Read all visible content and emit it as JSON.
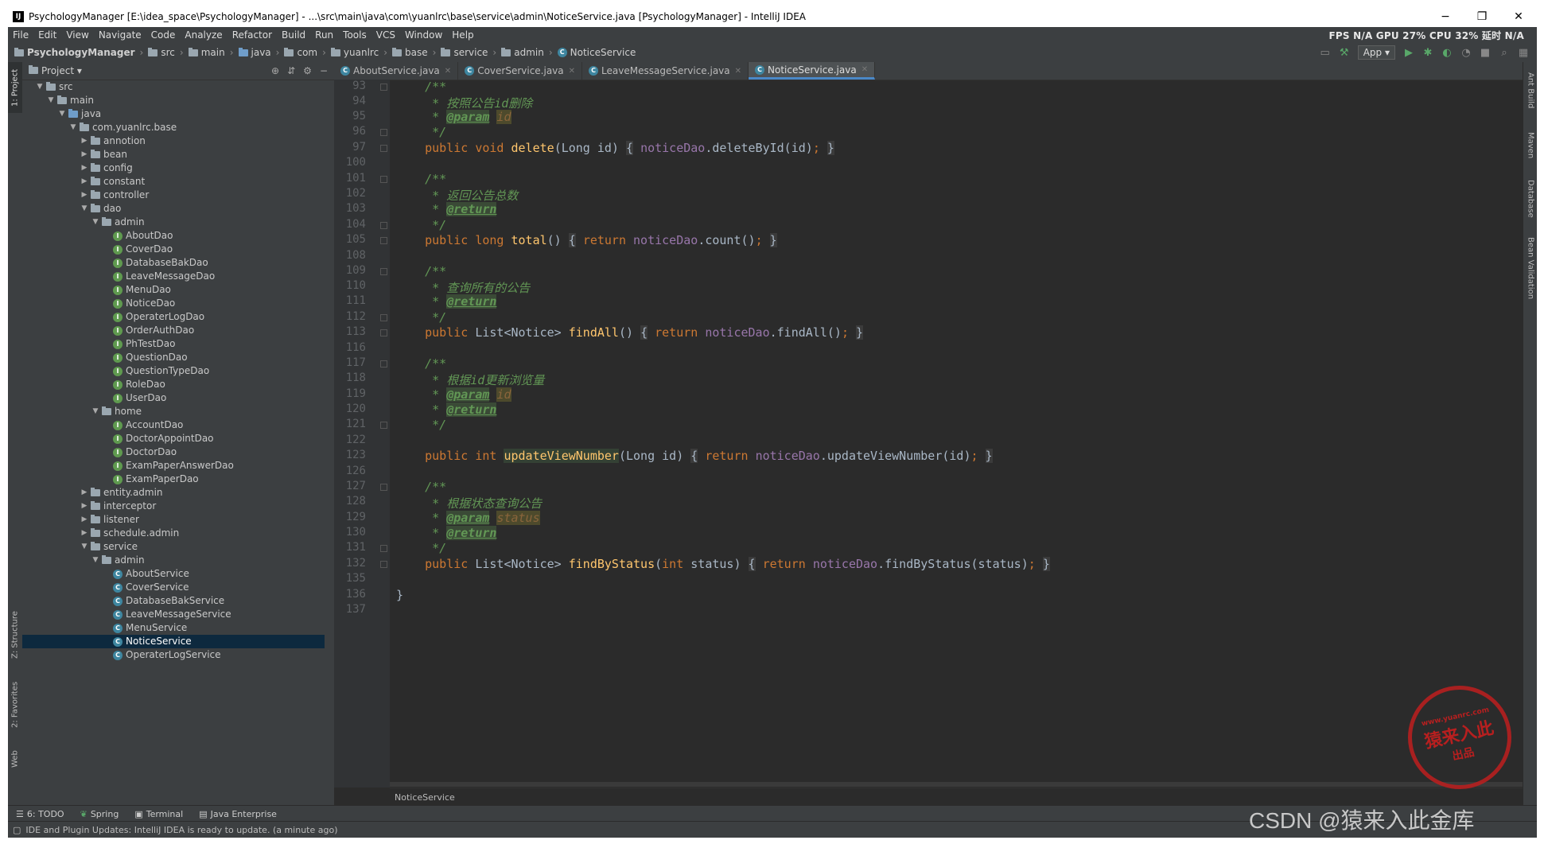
{
  "window": {
    "title": "PsychologyManager [E:\\idea_space\\PsychologyManager] - ...\\src\\main\\java\\com\\yuanlrc\\base\\service\\admin\\NoticeService.java [PsychologyManager] - IntelliJ IDEA",
    "app_icon": "IJ",
    "minimize": "−",
    "maximize": "❐",
    "close": "✕"
  },
  "menu": [
    "File",
    "Edit",
    "View",
    "Navigate",
    "Code",
    "Analyze",
    "Refactor",
    "Build",
    "Run",
    "Tools",
    "VCS",
    "Window",
    "Help"
  ],
  "perf_stats": "FPS N/A GPU 27% CPU 32% 延时 N/A",
  "breadcrumb": [
    "PsychologyManager",
    "src",
    "main",
    "java",
    "com",
    "yuanlrc",
    "base",
    "service",
    "admin",
    "NoticeService"
  ],
  "run_config": "App",
  "left_tabs": [
    "1: Project",
    "Z: Structure",
    "2: Favorites",
    "Web"
  ],
  "right_tabs": [
    "Ant Build",
    "Maven",
    "Database",
    "Bean Validation"
  ],
  "project_panel": {
    "title": "Project",
    "tree": [
      {
        "label": "src",
        "depth": 1,
        "expanded": true,
        "kind": "folder"
      },
      {
        "label": "main",
        "depth": 2,
        "expanded": true,
        "kind": "folder"
      },
      {
        "label": "java",
        "depth": 3,
        "expanded": true,
        "kind": "folder-blue"
      },
      {
        "label": "com.yuanlrc.base",
        "depth": 4,
        "expanded": true,
        "kind": "folder"
      },
      {
        "label": "annotion",
        "depth": 5,
        "expanded": false,
        "kind": "folder"
      },
      {
        "label": "bean",
        "depth": 5,
        "expanded": false,
        "kind": "folder"
      },
      {
        "label": "config",
        "depth": 5,
        "expanded": false,
        "kind": "folder"
      },
      {
        "label": "constant",
        "depth": 5,
        "expanded": false,
        "kind": "folder"
      },
      {
        "label": "controller",
        "depth": 5,
        "expanded": false,
        "kind": "folder"
      },
      {
        "label": "dao",
        "depth": 5,
        "expanded": true,
        "kind": "folder"
      },
      {
        "label": "admin",
        "depth": 6,
        "expanded": true,
        "kind": "folder"
      },
      {
        "label": "AboutDao",
        "depth": 7,
        "kind": "interface"
      },
      {
        "label": "CoverDao",
        "depth": 7,
        "kind": "interface"
      },
      {
        "label": "DatabaseBakDao",
        "depth": 7,
        "kind": "interface"
      },
      {
        "label": "LeaveMessageDao",
        "depth": 7,
        "kind": "interface"
      },
      {
        "label": "MenuDao",
        "depth": 7,
        "kind": "interface"
      },
      {
        "label": "NoticeDao",
        "depth": 7,
        "kind": "interface"
      },
      {
        "label": "OperaterLogDao",
        "depth": 7,
        "kind": "interface"
      },
      {
        "label": "OrderAuthDao",
        "depth": 7,
        "kind": "interface"
      },
      {
        "label": "PhTestDao",
        "depth": 7,
        "kind": "interface"
      },
      {
        "label": "QuestionDao",
        "depth": 7,
        "kind": "interface"
      },
      {
        "label": "QuestionTypeDao",
        "depth": 7,
        "kind": "interface"
      },
      {
        "label": "RoleDao",
        "depth": 7,
        "kind": "interface"
      },
      {
        "label": "UserDao",
        "depth": 7,
        "kind": "interface"
      },
      {
        "label": "home",
        "depth": 6,
        "expanded": true,
        "kind": "folder"
      },
      {
        "label": "AccountDao",
        "depth": 7,
        "kind": "interface"
      },
      {
        "label": "DoctorAppointDao",
        "depth": 7,
        "kind": "interface"
      },
      {
        "label": "DoctorDao",
        "depth": 7,
        "kind": "interface"
      },
      {
        "label": "ExamPaperAnswerDao",
        "depth": 7,
        "kind": "interface"
      },
      {
        "label": "ExamPaperDao",
        "depth": 7,
        "kind": "interface"
      },
      {
        "label": "entity.admin",
        "depth": 5,
        "expanded": false,
        "kind": "folder"
      },
      {
        "label": "interceptor",
        "depth": 5,
        "expanded": false,
        "kind": "folder"
      },
      {
        "label": "listener",
        "depth": 5,
        "expanded": false,
        "kind": "folder"
      },
      {
        "label": "schedule.admin",
        "depth": 5,
        "expanded": false,
        "kind": "folder"
      },
      {
        "label": "service",
        "depth": 5,
        "expanded": true,
        "kind": "folder"
      },
      {
        "label": "admin",
        "depth": 6,
        "expanded": true,
        "kind": "folder"
      },
      {
        "label": "AboutService",
        "depth": 7,
        "kind": "class"
      },
      {
        "label": "CoverService",
        "depth": 7,
        "kind": "class"
      },
      {
        "label": "DatabaseBakService",
        "depth": 7,
        "kind": "class"
      },
      {
        "label": "LeaveMessageService",
        "depth": 7,
        "kind": "class"
      },
      {
        "label": "MenuService",
        "depth": 7,
        "kind": "class"
      },
      {
        "label": "NoticeService",
        "depth": 7,
        "kind": "class",
        "selected": true
      },
      {
        "label": "OperaterLogService",
        "depth": 7,
        "kind": "class"
      }
    ]
  },
  "editor_tabs": [
    {
      "label": "AboutService.java",
      "active": false
    },
    {
      "label": "CoverService.java",
      "active": false
    },
    {
      "label": "LeaveMessageService.java",
      "active": false
    },
    {
      "label": "NoticeService.java",
      "active": true
    }
  ],
  "line_numbers": [
    "93",
    "94",
    "95",
    "96",
    "97",
    "100",
    "101",
    "102",
    "103",
    "104",
    "105",
    "108",
    "109",
    "110",
    "111",
    "112",
    "113",
    "116",
    "117",
    "118",
    "119",
    "120",
    "121",
    "122",
    "123",
    "126",
    "127",
    "128",
    "129",
    "130",
    "131",
    "132",
    "135",
    "136",
    "137"
  ],
  "editor_breadcrumb": "NoticeService",
  "tool_windows": [
    "6: TODO",
    "Spring",
    "Terminal",
    "Java Enterprise"
  ],
  "status_message": "IDE and Plugin Updates: IntelliJ IDEA is ready to update. (a minute ago)",
  "watermark": {
    "csdn": "CSDN @猿来入此金库",
    "stamp_url": "www.yuanrc.com",
    "stamp_main": "猿来入此",
    "stamp_sub": "出品"
  }
}
